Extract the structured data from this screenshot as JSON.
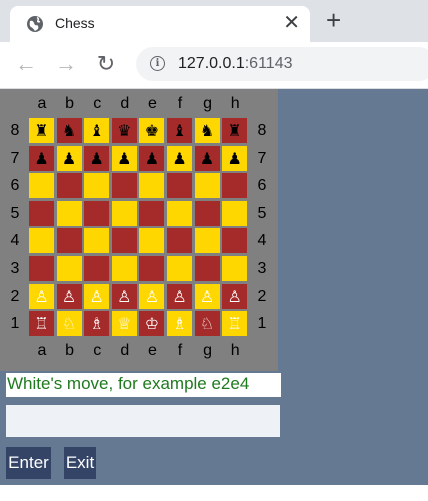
{
  "browser": {
    "tab_title": "Chess",
    "close_glyph": "✕",
    "newtab_glyph": "+",
    "back_glyph": "←",
    "forward_glyph": "→",
    "reload_glyph": "↻",
    "info_glyph": "i",
    "url_host": "127.0.0.1",
    "url_port": ":61143"
  },
  "board": {
    "files": [
      "a",
      "b",
      "c",
      "d",
      "e",
      "f",
      "g",
      "h"
    ],
    "ranks": [
      "8",
      "7",
      "6",
      "5",
      "4",
      "3",
      "2",
      "1"
    ],
    "rows": [
      [
        "♜",
        "♞",
        "♝",
        "♛",
        "♚",
        "♝",
        "♞",
        "♜"
      ],
      [
        "♟",
        "♟",
        "♟",
        "♟",
        "♟",
        "♟",
        "♟",
        "♟"
      ],
      [
        "",
        "",
        "",
        "",
        "",
        "",
        "",
        ""
      ],
      [
        "",
        "",
        "",
        "",
        "",
        "",
        "",
        ""
      ],
      [
        "",
        "",
        "",
        "",
        "",
        "",
        "",
        ""
      ],
      [
        "",
        "",
        "",
        "",
        "",
        "",
        "",
        ""
      ],
      [
        "♙",
        "♙",
        "♙",
        "♙",
        "♙",
        "♙",
        "♙",
        "♙"
      ],
      [
        "♖",
        "♘",
        "♗",
        "♕",
        "♔",
        "♗",
        "♘",
        "♖"
      ]
    ],
    "light_color": "#ffd700",
    "dark_color": "#a52a2a"
  },
  "status_text": "White's move, for example e2e4",
  "move_input": {
    "value": "",
    "placeholder": ""
  },
  "buttons": {
    "enter_label": "Enter",
    "exit_label": "Exit"
  },
  "colors": {
    "page_background": "#667993",
    "board_background": "#808080",
    "button_background": "#334466",
    "status_text": "#1f7a1f"
  }
}
